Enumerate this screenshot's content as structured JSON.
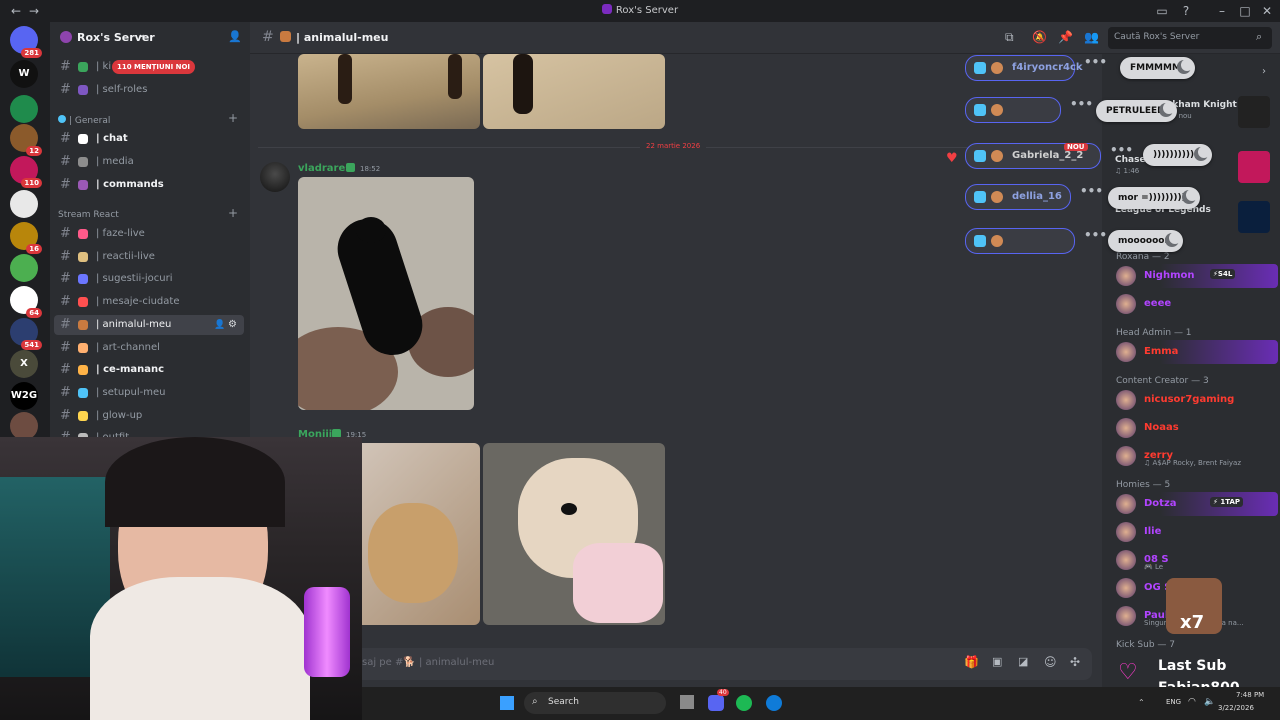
{
  "window": {
    "title": "Rox's Server"
  },
  "servers": [
    {
      "label": "",
      "badge": "281",
      "color": "#5865f2"
    },
    {
      "label": "W",
      "badge": "",
      "color": "#111111"
    },
    {
      "label": "",
      "badge": "",
      "color": "#1f8b4c"
    },
    {
      "label": "",
      "badge": "12",
      "color": "#8b5a2b"
    },
    {
      "label": "",
      "badge": "110",
      "color": "#c2185b"
    },
    {
      "label": "",
      "badge": "",
      "color": "#e8e8e8"
    },
    {
      "label": "",
      "badge": "16",
      "color": "#b8860b"
    },
    {
      "label": "",
      "badge": "",
      "color": "#4caf50"
    },
    {
      "label": "",
      "badge": "64",
      "color": "#ffffff"
    },
    {
      "label": "",
      "badge": "541",
      "color": "#2c3e70"
    },
    {
      "label": "X",
      "badge": "",
      "color": "#4a4a3a"
    },
    {
      "label": "W2G",
      "badge": "",
      "color": "#000000"
    },
    {
      "label": "",
      "badge": "",
      "color": "#6d4c41"
    }
  ],
  "sidebar": {
    "server_name": "Rox's Server",
    "mentions_badge": "110 MENȚIUNI NOI",
    "channels_top": [
      {
        "label": "| ki",
        "color": "#3ba55c",
        "bold": false
      },
      {
        "label": "| self-roles",
        "color": "#7e57c2",
        "bold": false
      }
    ],
    "category_general": "| General",
    "channels_general": [
      {
        "label": "| chat",
        "color": "#ffffff",
        "bold": true
      },
      {
        "label": "| media",
        "color": "#8d8d8d",
        "bold": false
      },
      {
        "label": "| commands",
        "color": "#9b59b6",
        "bold": true
      }
    ],
    "category_stream": "Stream React",
    "channels_stream": [
      {
        "label": "| faze-live",
        "color": "#ff5a8a",
        "bold": false
      },
      {
        "label": "| reactii-live",
        "color": "#e0c080",
        "bold": false
      },
      {
        "label": "| sugestii-jocuri",
        "color": "#6b76ff",
        "bold": false
      },
      {
        "label": "| mesaje-ciudate",
        "color": "#ff5050",
        "bold": false
      },
      {
        "label": "| animalul-meu",
        "color": "#c97a40",
        "bold": false,
        "selected": true
      },
      {
        "label": "| art-channel",
        "color": "#ffb070",
        "bold": false
      },
      {
        "label": "| ce-mananc",
        "color": "#ffb347",
        "bold": true
      },
      {
        "label": "| setupul-meu",
        "color": "#4fc3f7",
        "bold": false
      },
      {
        "label": "| glow-up",
        "color": "#ffd54f",
        "bold": false
      },
      {
        "label": "| outfit",
        "color": "#bbbbbb",
        "bold": false
      }
    ]
  },
  "header": {
    "channel": "| animalul-meu",
    "search_placeholder": "Caută Rox's Server"
  },
  "messages": {
    "date_divider": "22 martie 2026",
    "msg1": {
      "author": "vladrares",
      "time": "18:52"
    },
    "msg2": {
      "author": "Moniii",
      "time": "19:15"
    }
  },
  "composer": {
    "placeholder": "saj pe #🐕 | animalul-meu"
  },
  "reactions": [
    {
      "name": "f4iryoncr4ck",
      "color": "#8ea1e1"
    },
    {
      "name": "",
      "color": "#ff4d4d"
    },
    {
      "name": "Gabriela_2_2",
      "color": "#d0d0d0"
    },
    {
      "name": "dellia_16",
      "color": "#8ea1e1"
    },
    {
      "name": "",
      "color": "#ff4d4d"
    }
  ],
  "overlay_pills": [
    "FMMMMM",
    "PETRULEEE",
    ")))))))))))",
    "mor =)))))))))",
    "moooooor"
  ],
  "new_badge": "NOU",
  "members": {
    "activity": [
      {
        "title": "Batman: Arkham Knight",
        "sub": "Acum 1z · Jucător nou"
      },
      {
        "title": "Chase Atlantic",
        "sub": "♫ 1:46"
      },
      {
        "title": "League of Legends",
        "sub": ""
      }
    ],
    "groups": [
      {
        "title": "Roxana — 2",
        "members": [
          {
            "name": "Nighmon",
            "tag": "⚡S4L",
            "color": "#b144ff",
            "sub": ""
          },
          {
            "name": "eeee",
            "tag": "",
            "color": "#b144ff",
            "sub": ""
          }
        ]
      },
      {
        "title": "Head Admin — 1",
        "members": [
          {
            "name": "Emma",
            "tag": "",
            "color": "#ff3b30",
            "sub": ""
          }
        ]
      },
      {
        "title": "Content Creator — 3",
        "members": [
          {
            "name": "nicusor7gaming",
            "tag": "",
            "color": "#ff3b30",
            "sub": ""
          },
          {
            "name": "Noaas",
            "tag": "",
            "color": "#ff3b30",
            "sub": ""
          },
          {
            "name": "zerry",
            "tag": "",
            "color": "#ff3b30",
            "sub": "♫ A$AP Rocky, Brent Faiyaz"
          }
        ]
      },
      {
        "title": "Homies — 5",
        "members": [
          {
            "name": "Dotza",
            "tag": "⚡ 1TAP",
            "color": "#b144ff",
            "sub": ""
          },
          {
            "name": "Ilie",
            "tag": "",
            "color": "#b144ff",
            "sub": ""
          },
          {
            "name": "08 S",
            "tag": "",
            "color": "#b144ff",
            "sub": "🎮 Le"
          },
          {
            "name": "OG S",
            "tag": "",
            "color": "#b144ff",
            "sub": ""
          },
          {
            "name": "Paul M",
            "tag": "",
            "color": "#b144ff",
            "sub": "Singurătatea e locuința na..."
          }
        ]
      }
    ],
    "kick_sub": "Kick Sub — 7"
  },
  "stream_overlay": {
    "last_sub_label": "Last Sub",
    "last_sub_name": "Fabian800",
    "multiplier": "x7"
  },
  "taskbar": {
    "search": "Search",
    "lang": "ENG",
    "time": "7:48 PM",
    "date": "3/22/2026",
    "discord_badge": "40"
  }
}
